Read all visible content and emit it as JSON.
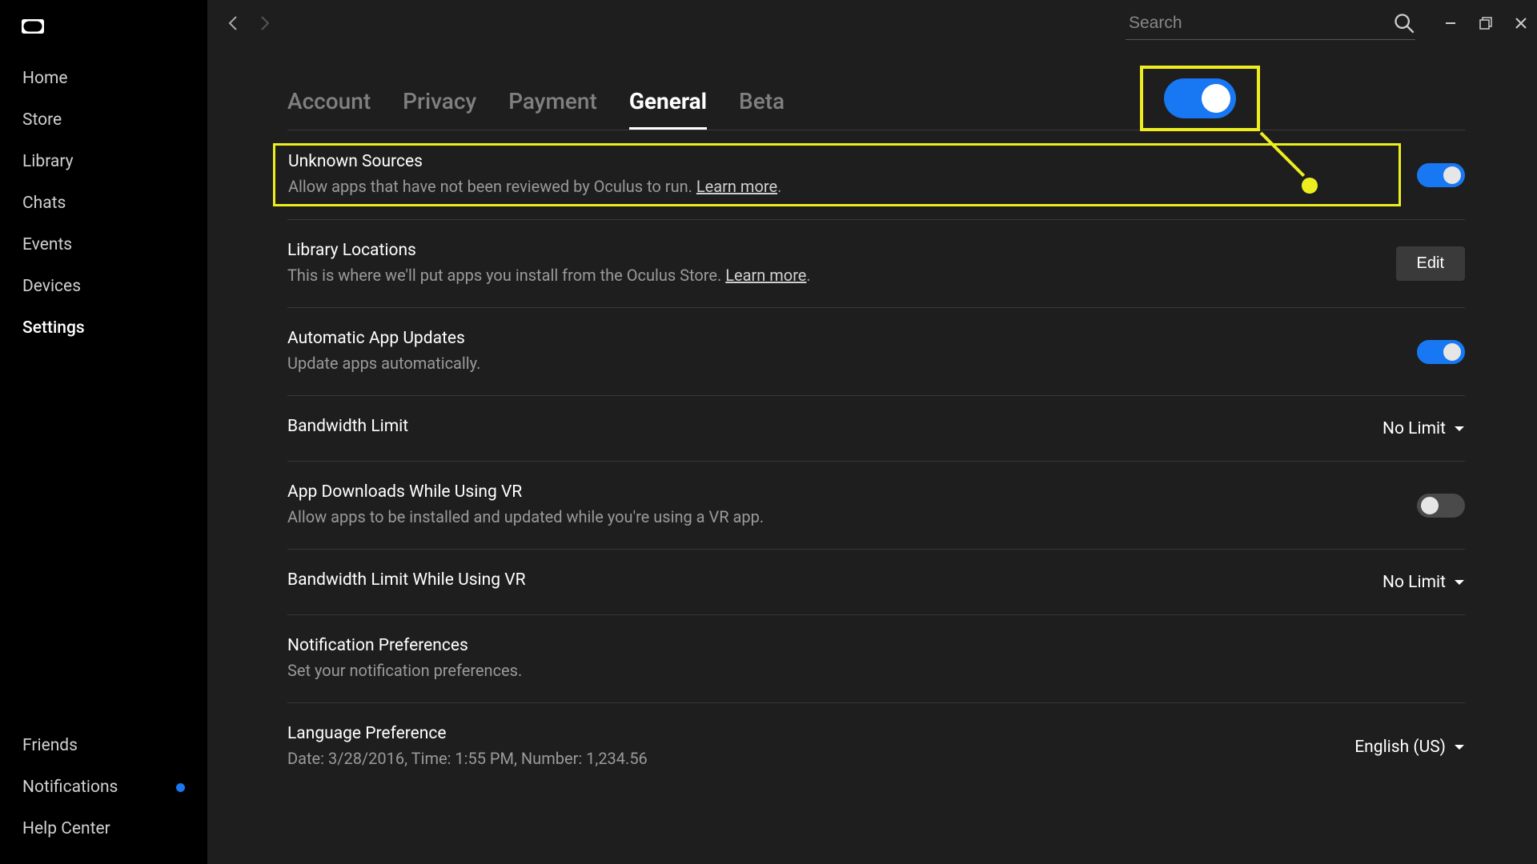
{
  "sidebar": {
    "primary": [
      "Home",
      "Store",
      "Library",
      "Chats",
      "Events",
      "Devices",
      "Settings"
    ],
    "active_primary": 6,
    "secondary": [
      {
        "label": "Friends",
        "dot": false
      },
      {
        "label": "Notifications",
        "dot": true
      },
      {
        "label": "Help Center",
        "dot": false
      }
    ]
  },
  "search": {
    "placeholder": "Search"
  },
  "tabs": {
    "items": [
      "Account",
      "Privacy",
      "Payment",
      "General",
      "Beta"
    ],
    "active": 3
  },
  "settings": {
    "unknown_sources": {
      "title": "Unknown Sources",
      "desc_pre": "Allow apps that have not been reviewed by Oculus to run. ",
      "link": "Learn more",
      "desc_post": ".",
      "toggle": true
    },
    "library_locations": {
      "title": "Library Locations",
      "desc_pre": "This is where we'll put apps you install from the Oculus Store. ",
      "link": "Learn more",
      "desc_post": ".",
      "button": "Edit"
    },
    "auto_updates": {
      "title": "Automatic App Updates",
      "desc": "Update apps automatically.",
      "toggle": true
    },
    "bandwidth": {
      "title": "Bandwidth Limit",
      "dropdown": "No Limit"
    },
    "downloads_vr": {
      "title": "App Downloads While Using VR",
      "desc": "Allow apps to be installed and updated while you're using a VR app.",
      "toggle": false
    },
    "bandwidth_vr": {
      "title": "Bandwidth Limit While Using VR",
      "dropdown": "No Limit"
    },
    "notifications": {
      "title": "Notification Preferences",
      "desc": "Set your notification preferences."
    },
    "language": {
      "title": "Language Preference",
      "desc": "Date: 3/28/2016, Time: 1:55 PM, Number: 1,234.56",
      "dropdown": "English (US)"
    }
  }
}
